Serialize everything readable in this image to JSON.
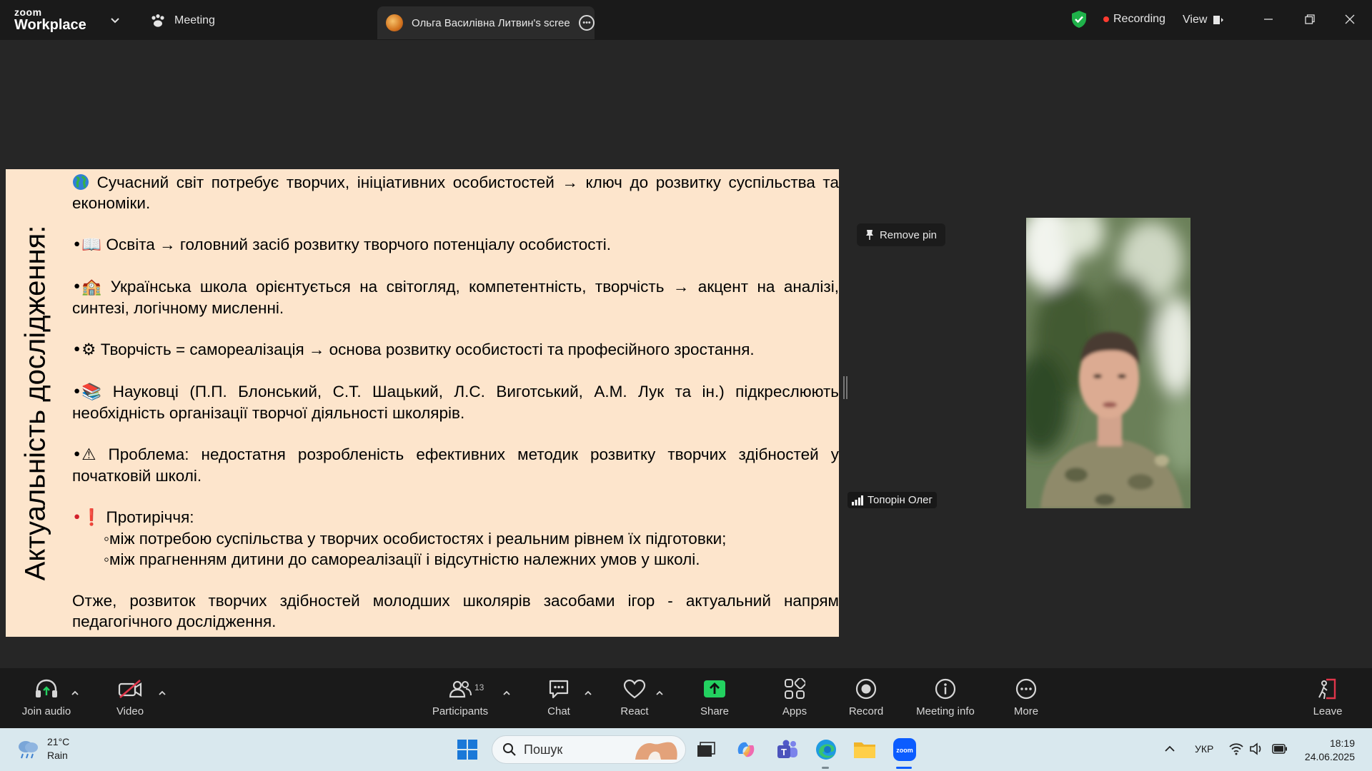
{
  "app": {
    "logo_top": "zoom",
    "logo_bottom": "Workplace"
  },
  "tabs": {
    "meeting_label": "Meeting",
    "share_label": "Ольга Василівна Литвин's screen"
  },
  "status": {
    "recording_label": "Recording",
    "view_label": "View"
  },
  "slide": {
    "vertical_title": "Актуальність дослідження:",
    "paragraphs": {
      "p1_icon": "🌍",
      "p1": " Сучасний світ потребує творчих, ініціативних особистостей → ключ до розвитку суспільства та економіки.",
      "p2_icon": "•📖",
      "p2": " Освіта → головний засіб розвитку творчого потенціалу особистості.",
      "p3_icon": "•🏫",
      "p3": " Українська школа орієнтується на світогляд, компетентність, творчість → акцент на аналізі, синтезі, логічному мисленні.",
      "p4_icon": "•⚙",
      "p4": " Творчість = самореалізація → основа розвитку особистості та професійного зростання.",
      "p5_icon": "•📚",
      "p5": " Науковці (П.П. Блонський, С.Т. Шацький, Л.С. Виготський, А.М. Лук та ін.) підкреслюють необхідність організації творчої діяльності школярів.",
      "p6_icon": "•⚠",
      "p6": " Проблема: недостатня розробленість ефективних методик розвитку творчих здібностей у початковій школі.",
      "p7_icon": "•❗",
      "p7": " Протиріччя:",
      "p7_sub1": "◦між потребою суспільства у творчих особистостях і реальним рівнем їх підготовки;",
      "p7_sub2": "◦між прагненням дитини до самореалізації і відсутністю належних умов у школі.",
      "p8": "Отже,  розвиток творчих здібностей молодших школярів засобами ігор - актуальний напрям педагогічного дослідження."
    }
  },
  "pin": {
    "remove_pin_label": "Remove pin"
  },
  "participant": {
    "name": "Топорін Олег"
  },
  "toolbar": {
    "join_audio": "Join audio",
    "video": "Video",
    "participants": "Participants",
    "participants_count": "13",
    "chat": "Chat",
    "react": "React",
    "share": "Share",
    "apps": "Apps",
    "record": "Record",
    "meeting_info": "Meeting info",
    "more": "More",
    "leave": "Leave"
  },
  "taskbar": {
    "temperature": "21°C",
    "condition": "Rain",
    "search_placeholder": "Пошук",
    "language": "УКР",
    "time": "18:19",
    "date": "24.06.2025"
  },
  "colors": {
    "slide_background": "#fde5cc",
    "share_green": "#23d160",
    "recording_red": "#ff3b30",
    "leave_red": "#e0364a"
  }
}
